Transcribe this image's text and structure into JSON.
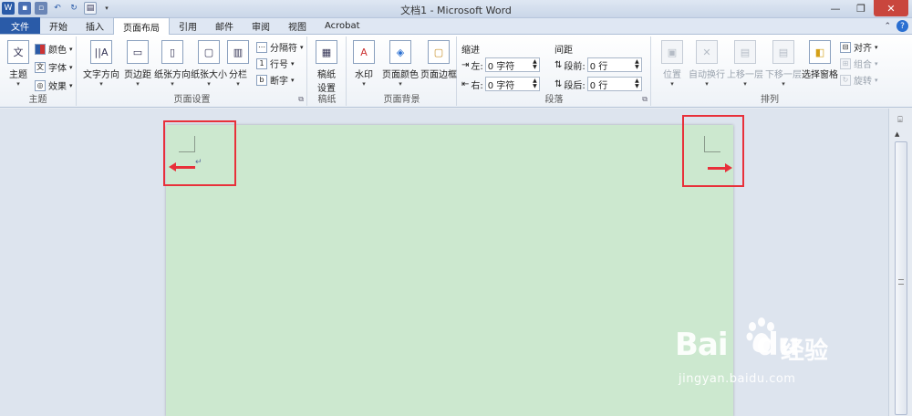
{
  "title": "文档1 - Microsoft Word",
  "tabs": [
    "文件",
    "开始",
    "插入",
    "页面布局",
    "引用",
    "邮件",
    "审阅",
    "视图",
    "Acrobat"
  ],
  "groups": {
    "theme": {
      "label": "主题",
      "big": "主题",
      "items": [
        "颜色",
        "字体",
        "效果"
      ]
    },
    "page_setup": {
      "label": "页面设置",
      "buttons": [
        "文字方向",
        "页边距",
        "纸张方向",
        "纸张大小",
        "分栏"
      ],
      "items": [
        "分隔符",
        "行号",
        "断字"
      ]
    },
    "draft": {
      "label": "稿纸",
      "button_line1": "稿纸",
      "button_line2": "设置"
    },
    "page_background": {
      "label": "页面背景",
      "buttons": [
        "水印",
        "页面颜色",
        "页面边框"
      ]
    },
    "paragraph": {
      "label": "段落",
      "indent_label": "缩进",
      "spacing_label": "间距",
      "left_label": "左:",
      "right_label": "右:",
      "before_label": "段前:",
      "after_label": "段后:",
      "left_value": "0 字符",
      "right_value": "0 字符",
      "before_value": "0 行",
      "after_value": "0 行"
    },
    "arrange": {
      "label": "排列",
      "buttons": [
        "位置",
        "自动换行",
        "上移一层",
        "下移一层",
        "选择窗格"
      ],
      "items": [
        "对齐",
        "组合",
        "旋转"
      ]
    }
  },
  "watermark": {
    "brand": "Bai",
    "brand2": "du",
    "cn": "经验",
    "url": "jingyan.baidu.com"
  },
  "colors": {
    "page_bg": "#cce8cf",
    "highlight": "#e8303a",
    "file_tab": "#2a5ba8"
  }
}
